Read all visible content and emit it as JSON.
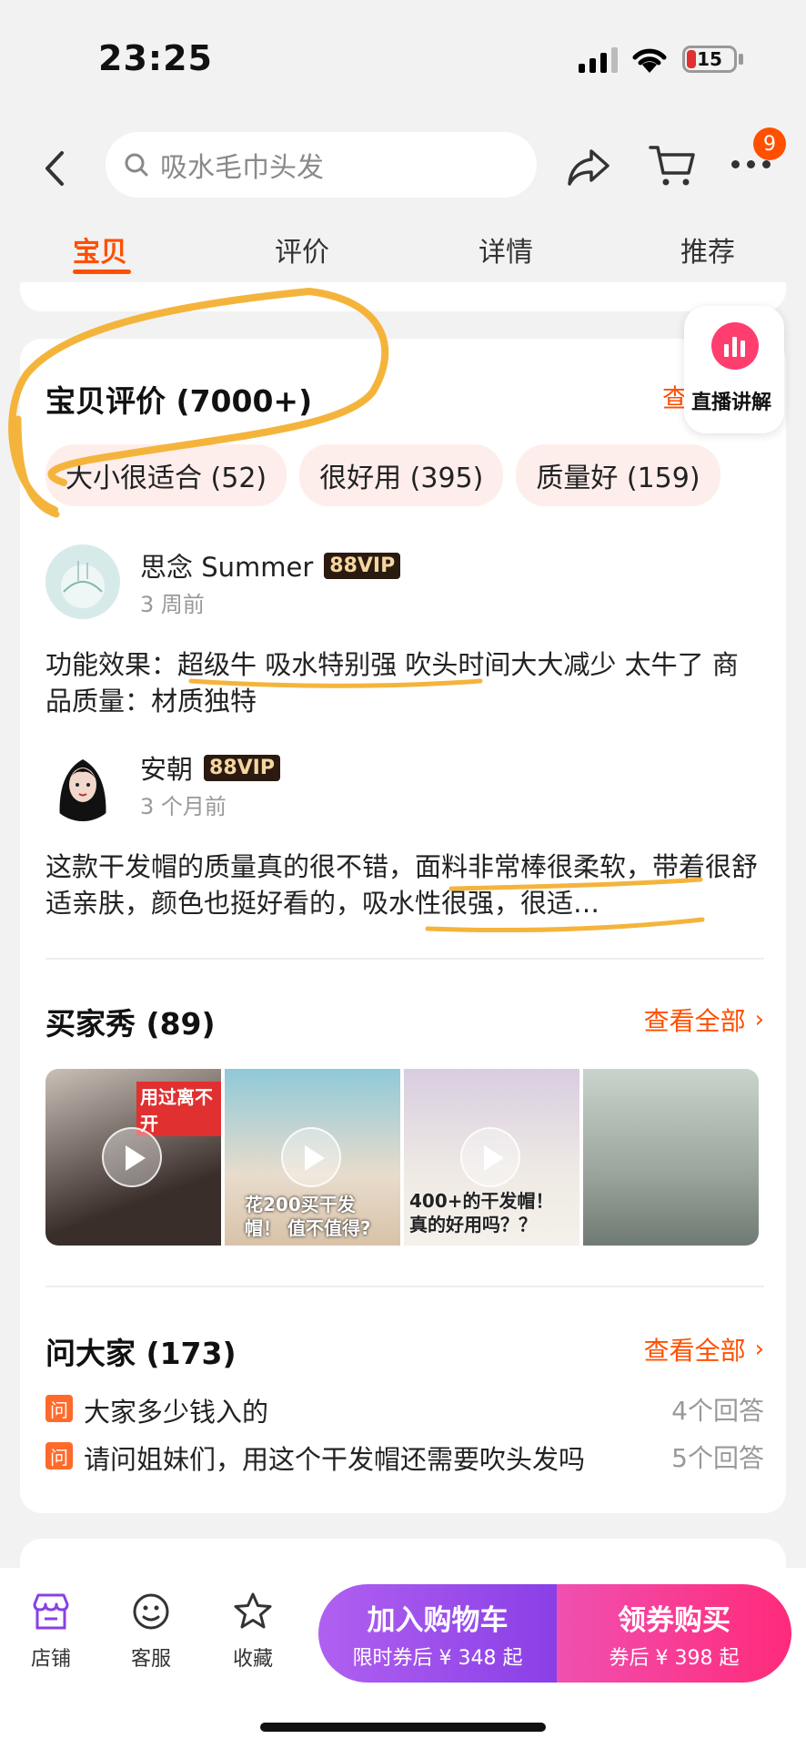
{
  "status": {
    "time": "23:25",
    "battery": "15"
  },
  "header": {
    "search_placeholder": "吸水毛巾头发",
    "cart_badge": "9"
  },
  "tabs": [
    {
      "label": "宝贝"
    },
    {
      "label": "评价"
    },
    {
      "label": "详情"
    },
    {
      "label": "推荐"
    }
  ],
  "live_float": {
    "label": "直播讲解"
  },
  "reviews_section": {
    "title": "宝贝评价 (7000+)",
    "see_all": "查看全部",
    "chips": [
      "大小很适合 (52)",
      "很好用 (395)",
      "质量好 (159)"
    ],
    "items": [
      {
        "name": "思念 Summer",
        "vip": "88VIP",
        "time": "3 周前",
        "text": "功能效果：超级牛 吸水特别强 吹头时间大大减少 太牛了 商品质量：材质独特"
      },
      {
        "name": "安朝",
        "vip": "88VIP",
        "time": "3 个月前",
        "text": "这款干发帽的质量真的很不错，面料非常棒很柔软，带着很舒适亲肤，颜色也挺好看的，吸水性很强，很适…"
      }
    ]
  },
  "buyer_show": {
    "title": "买家秀 (89)",
    "see_all": "查看全部",
    "captions": [
      "用过离不开",
      "花200买干发帽！ 值不值得?",
      "400+的干发帽！ 真的好用吗？？",
      ""
    ]
  },
  "qa_section": {
    "title": "问大家 (173)",
    "see_all": "查看全部",
    "icon_label": "问",
    "items": [
      {
        "question": "大家多少钱入的",
        "answers": "4个回答"
      },
      {
        "question": "请问姐妹们，用这个干发帽还需要吹头发吗",
        "answers": "5个回答"
      }
    ]
  },
  "bottom_bar": {
    "shop": "店铺",
    "service": "客服",
    "favorite": "收藏",
    "add_cart": "加入购物车",
    "add_cart_sub": "限时券后 ¥ 348 起",
    "buy": "领券购买",
    "buy_sub": "券后 ¥ 398 起"
  },
  "colors": {
    "accent": "#ff5000",
    "annotation": "#f4b43c"
  }
}
